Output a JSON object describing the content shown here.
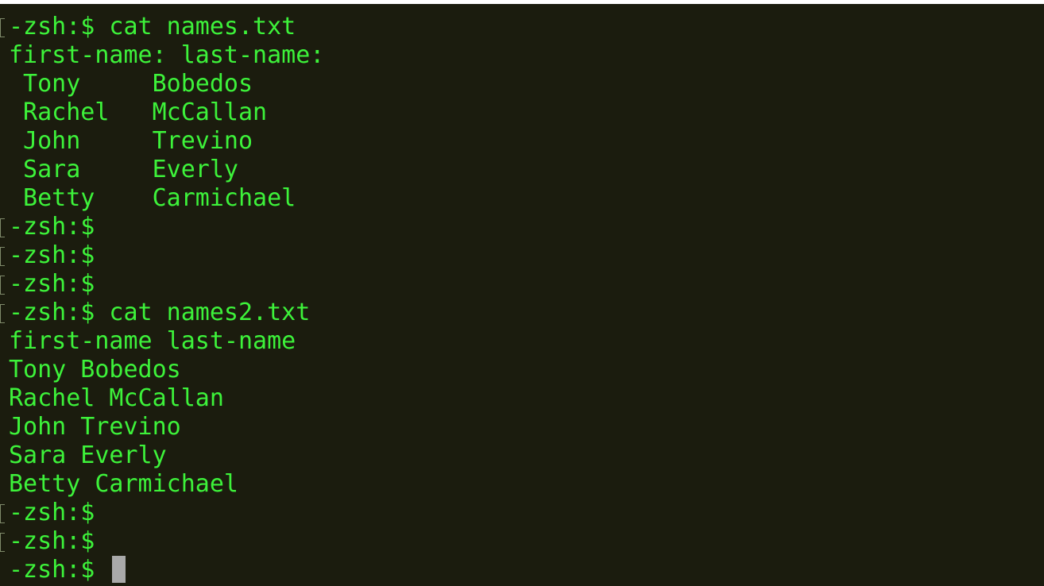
{
  "terminal": {
    "colors": {
      "background": "#1b1c0e",
      "text": "#3df23a",
      "cursor": "#a9a9a9",
      "mark": "#7f8a6a"
    },
    "lines": [
      {
        "text": "-zsh:$ cat names.txt",
        "marked": true
      },
      {
        "text": "first-name: last-name:",
        "marked": false
      },
      {
        "text": " Tony     Bobedos",
        "marked": false
      },
      {
        "text": " Rachel   McCallan",
        "marked": false
      },
      {
        "text": " John     Trevino",
        "marked": false
      },
      {
        "text": " Sara     Everly",
        "marked": false
      },
      {
        "text": " Betty    Carmichael",
        "marked": false
      },
      {
        "text": "-zsh:$",
        "marked": true
      },
      {
        "text": "-zsh:$",
        "marked": true
      },
      {
        "text": "-zsh:$",
        "marked": true
      },
      {
        "text": "-zsh:$ cat names2.txt",
        "marked": true
      },
      {
        "text": "first-name last-name",
        "marked": false
      },
      {
        "text": "Tony Bobedos",
        "marked": false
      },
      {
        "text": "Rachel McCallan",
        "marked": false
      },
      {
        "text": "John Trevino",
        "marked": false
      },
      {
        "text": "Sara Everly",
        "marked": false
      },
      {
        "text": "Betty Carmichael",
        "marked": false
      },
      {
        "text": "-zsh:$",
        "marked": true
      },
      {
        "text": "-zsh:$",
        "marked": true
      }
    ],
    "prompt": {
      "text": "-zsh:$ "
    }
  }
}
